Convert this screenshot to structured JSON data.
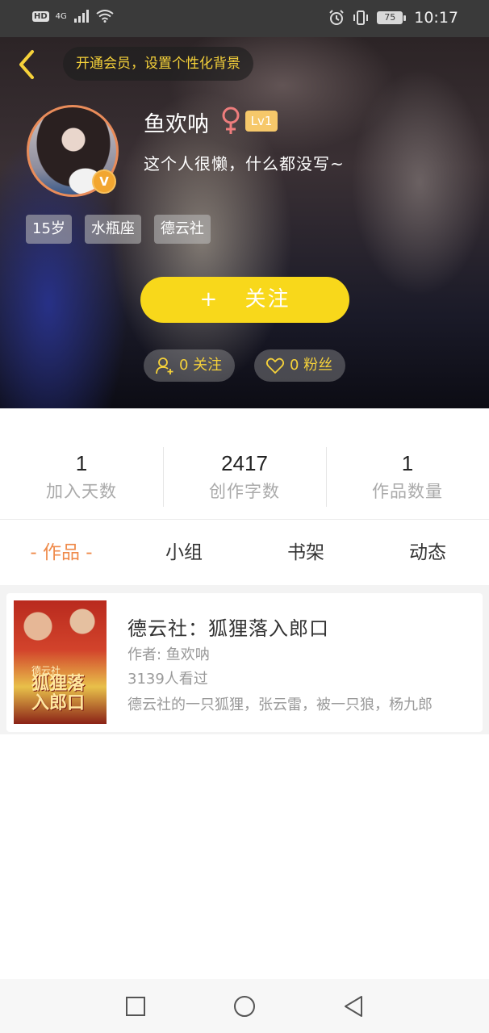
{
  "status_bar": {
    "hd": "HD",
    "network": "4G",
    "battery": "75",
    "time": "10:17"
  },
  "header": {
    "member_banner": "开通会员，设置个性化背景",
    "username": "鱼欢呐",
    "level": "Lv1",
    "verify_mark": "V",
    "bio": "这个人很懒，什么都没写~",
    "tags": [
      "15岁",
      "水瓶座",
      "德云社"
    ],
    "follow_plus": "+",
    "follow_label": "关注",
    "following": "0 关注",
    "fans": "0 粉丝"
  },
  "stats": [
    {
      "value": "1",
      "label": "加入天数"
    },
    {
      "value": "2417",
      "label": "创作字数"
    },
    {
      "value": "1",
      "label": "作品数量"
    }
  ],
  "tabs": [
    {
      "label": "- 作品 -",
      "active": true
    },
    {
      "label": "小组",
      "active": false
    },
    {
      "label": "书架",
      "active": false
    },
    {
      "label": "动态",
      "active": false
    }
  ],
  "works": [
    {
      "title": "德云社：狐狸落入郎口",
      "author": "作者: 鱼欢呐",
      "views": "3139人看过",
      "description": "德云社的一只狐狸，张云雷，被一只狼，杨九郎",
      "cover_text": "狐狸落入郎口",
      "cover_small": "德云社"
    }
  ],
  "colors": {
    "accent_yellow": "#f8d81b",
    "banner_text": "#f6d23a",
    "tab_active": "#ef8a4a"
  }
}
